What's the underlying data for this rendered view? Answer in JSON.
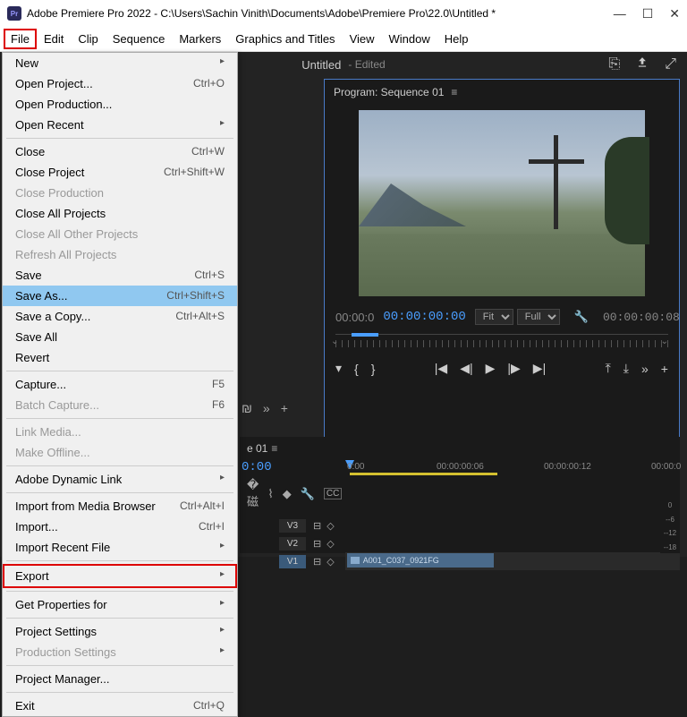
{
  "titlebar": {
    "app_icon_text": "Pr",
    "title": "Adobe Premiere Pro 2022 - C:\\Users\\Sachin Vinith\\Documents\\Adobe\\Premiere Pro\\22.0\\Untitled *"
  },
  "menubar": [
    "File",
    "Edit",
    "Clip",
    "Sequence",
    "Markers",
    "Graphics and Titles",
    "View",
    "Window",
    "Help"
  ],
  "top_tabs": {
    "name": "Untitled",
    "status": "- Edited"
  },
  "program": {
    "title": "Program: Sequence 01",
    "tc_left": "00:00:0",
    "tc_main": "00:00:00:00",
    "fit": "Fit",
    "full": "Full",
    "tc_right": "00:00:00:08",
    "scrub_markers": [
      "⌄",
      "⌄"
    ]
  },
  "file_menu": [
    {
      "label": "New",
      "sub": true
    },
    {
      "label": "Open Project...",
      "shortcut": "Ctrl+O"
    },
    {
      "label": "Open Production..."
    },
    {
      "label": "Open Recent",
      "sub": true
    },
    {
      "sep": true
    },
    {
      "label": "Close",
      "shortcut": "Ctrl+W"
    },
    {
      "label": "Close Project",
      "shortcut": "Ctrl+Shift+W"
    },
    {
      "label": "Close Production",
      "disabled": true
    },
    {
      "label": "Close All Projects"
    },
    {
      "label": "Close All Other Projects",
      "disabled": true
    },
    {
      "label": "Refresh All Projects",
      "disabled": true
    },
    {
      "label": "Save",
      "shortcut": "Ctrl+S"
    },
    {
      "label": "Save As...",
      "shortcut": "Ctrl+Shift+S",
      "high_blue": true
    },
    {
      "label": "Save a Copy...",
      "shortcut": "Ctrl+Alt+S"
    },
    {
      "label": "Save All"
    },
    {
      "label": "Revert"
    },
    {
      "sep": true
    },
    {
      "label": "Capture...",
      "shortcut": "F5"
    },
    {
      "label": "Batch Capture...",
      "shortcut": "F6",
      "disabled": true
    },
    {
      "sep": true
    },
    {
      "label": "Link Media...",
      "disabled": true
    },
    {
      "label": "Make Offline...",
      "disabled": true
    },
    {
      "sep": true
    },
    {
      "label": "Adobe Dynamic Link",
      "sub": true
    },
    {
      "sep": true
    },
    {
      "label": "Import from Media Browser",
      "shortcut": "Ctrl+Alt+I"
    },
    {
      "label": "Import...",
      "shortcut": "Ctrl+I"
    },
    {
      "label": "Import Recent File",
      "sub": true
    },
    {
      "sep": true
    },
    {
      "label": "Export",
      "sub": true,
      "high_red": true
    },
    {
      "sep": true
    },
    {
      "label": "Get Properties for",
      "sub": true
    },
    {
      "sep": true
    },
    {
      "label": "Project Settings",
      "sub": true
    },
    {
      "label": "Production Settings",
      "sub": true,
      "disabled": true
    },
    {
      "sep": true
    },
    {
      "label": "Project Manager..."
    },
    {
      "sep": true
    },
    {
      "label": "Exit",
      "shortcut": "Ctrl+Q"
    }
  ],
  "timeline": {
    "seq_label": "e 01",
    "tc": "0:00",
    "ruler": [
      "0:00",
      "00:00:00:06",
      "00:00:00:12",
      "00:00:0"
    ],
    "tracks": {
      "v3": "V3",
      "v2": "V2",
      "v1": "V1",
      "clip": "A001_C037_0921FG"
    },
    "meter": [
      "0",
      "--6",
      "--12",
      "--18"
    ]
  }
}
